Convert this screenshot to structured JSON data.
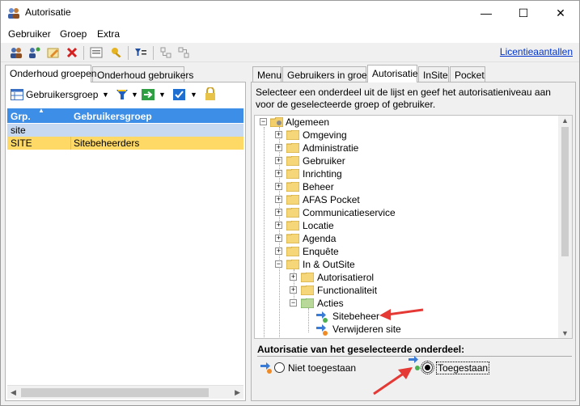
{
  "window": {
    "title": "Autorisatie",
    "controls": {
      "minimize": "—",
      "maximize": "☐",
      "close": "✕"
    }
  },
  "menu": [
    "Gebruiker",
    "Groep",
    "Extra"
  ],
  "toolbar": {
    "license_link": "Licentieaantallen",
    "icons": [
      "add-users-icon",
      "add-user-icon",
      "edit-icon",
      "delete-icon",
      "properties-icon",
      "key-icon",
      "filter-list-icon",
      "tree-collapse-icon",
      "tree-expand-icon"
    ]
  },
  "left_tabs": [
    "Onderhoud groepen",
    "Onderhoud gebruikers"
  ],
  "left_toolbar": {
    "group_dropdown": "Gebruikersgroep"
  },
  "grid": {
    "columns": [
      "Grp.",
      "Gebruikersgroep"
    ],
    "rows": [
      {
        "grp": "site",
        "group": ""
      },
      {
        "grp": "SITE",
        "group": "Sitebeheerders"
      }
    ]
  },
  "right_tabs": [
    "Menu",
    "Gebruikers in groep",
    "Autorisatie",
    "InSite",
    "Pocket"
  ],
  "instructions": "Selecteer een onderdeel uit de lijst en geef het autorisatieniveau aan voor de geselecteerde groep of gebruiker.",
  "tree": {
    "root": "Algemeen",
    "level1": [
      "Omgeving",
      "Administratie",
      "Gebruiker",
      "Inrichting",
      "Beheer",
      "AFAS Pocket",
      "Communicatieservice",
      "Locatie",
      "Agenda",
      "Enquête",
      "In & OutSite"
    ],
    "level2": [
      "Autorisatierol",
      "Functionaliteit",
      "Acties"
    ],
    "level3": [
      "Sitebeheer",
      "Verwijderen site"
    ]
  },
  "authorization": {
    "label": "Autorisatie van het geselecteerde onderdeel:",
    "options": [
      "Niet toegestaan",
      "Toegestaan"
    ],
    "selected": "Toegestaan"
  },
  "colors": {
    "grid_header": "#3d8ee6",
    "selected_row": "#ffd966",
    "site_row": "#c6d9f1",
    "annotation_arrow": "#e53935",
    "link": "#0033cc"
  }
}
